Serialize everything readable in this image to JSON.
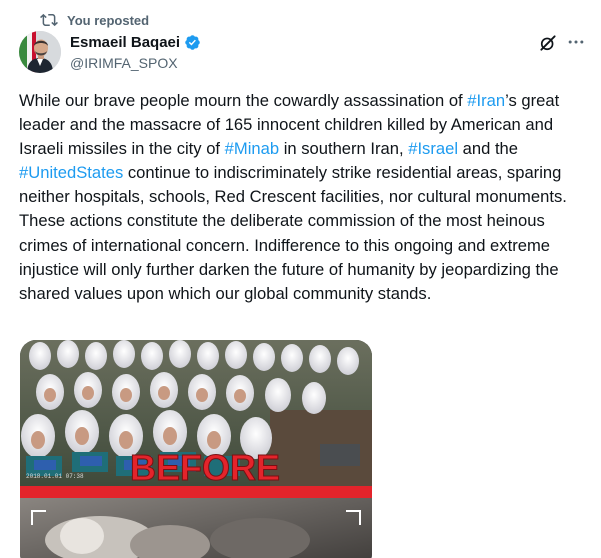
{
  "repost": {
    "label": "You reposted",
    "icon": "repost-icon"
  },
  "author": {
    "name": "Esmaeil Baqaei",
    "handle": "@IRIMFA_SPOX",
    "verified_icon": "verified-badge-icon",
    "avatar": "avatar"
  },
  "actions": {
    "grok": "grok-icon",
    "more": "more-options-icon"
  },
  "tweet": {
    "p1": "While our brave people mourn the cowardly assassination of ",
    "h1": "#Iran",
    "p2": "’s great leader and the massacre of 165 innocent children killed by American and Israeli missiles in the city of ",
    "h2": "#Minab",
    "p3": " in southern Iran, ",
    "h3": "#Israel",
    "p4": " and the ",
    "h4": "#UnitedStates",
    "p5": " continue to indiscriminately strike residential areas, sparing neither hospitals, schools, Red Crescent facilities, nor cultural monuments. These actions constitute the deliberate commission of the most heinous crimes of international concern. Indifference to this ongoing and extreme injustice will only further darken the future of humanity by jeopardizing the shared values upon which our global community stands."
  },
  "media": {
    "overlay_text": "BEFORE",
    "stamp": "2018.01.01 07:38",
    "colors": {
      "accent_red": "#e3242b"
    }
  },
  "colors": {
    "link": "#1d9bf0",
    "muted": "#536471",
    "text": "#0f1419",
    "verified": "#1d9bf0"
  }
}
